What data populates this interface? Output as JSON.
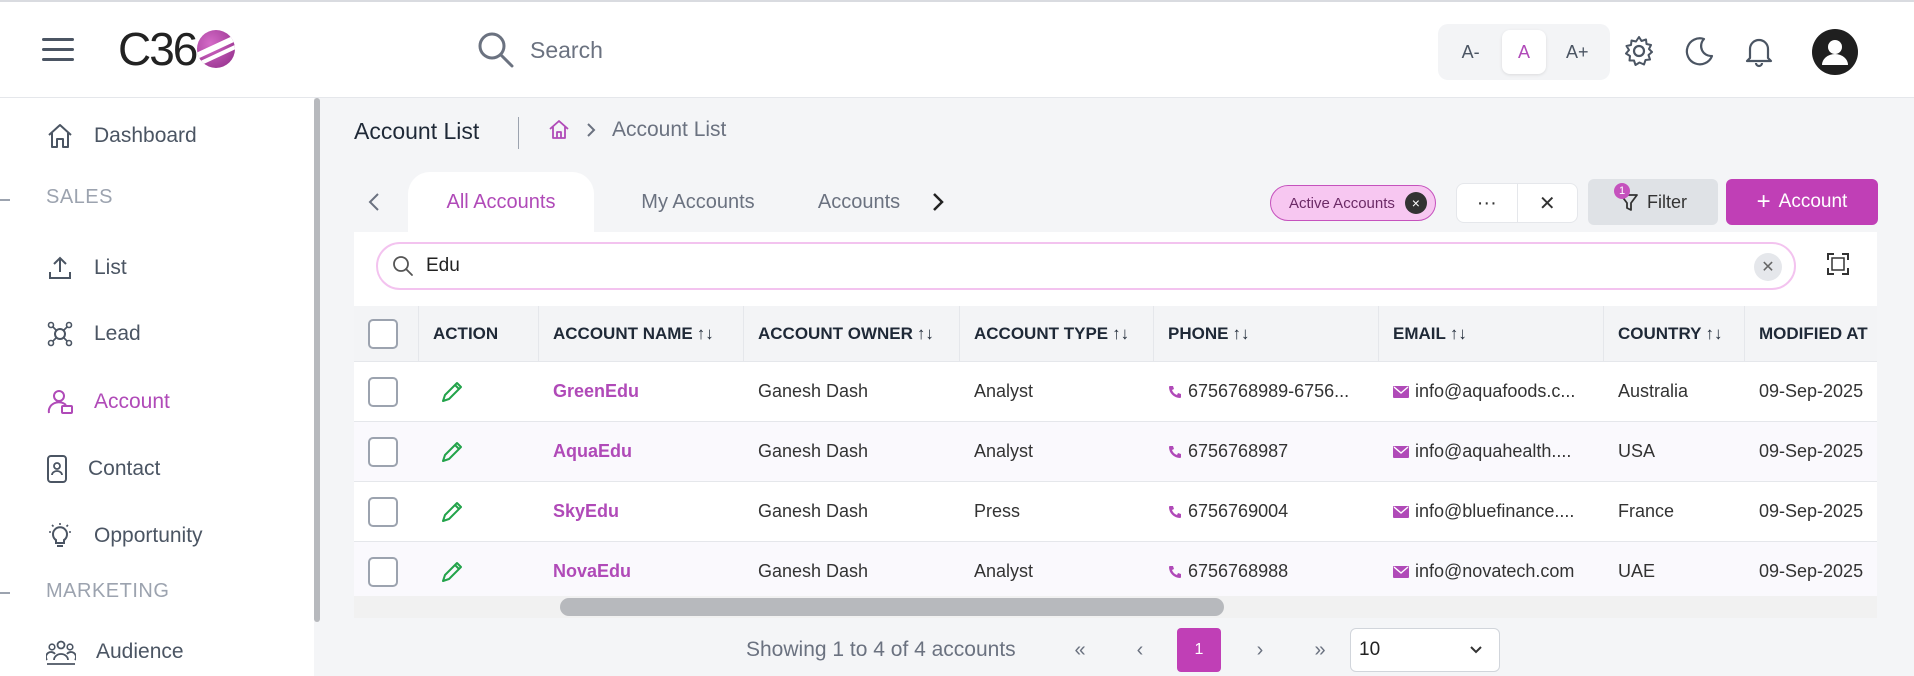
{
  "app": {
    "logo_text": "C36"
  },
  "header": {
    "search_placeholder": "Search",
    "font_small": "A-",
    "font_normal": "A",
    "font_large": "A+"
  },
  "sidebar": {
    "items": [
      {
        "label": "Dashboard",
        "icon": "home-icon"
      },
      {
        "label": "List",
        "icon": "upload-icon"
      },
      {
        "label": "Lead",
        "icon": "lead-icon"
      },
      {
        "label": "Account",
        "icon": "account-icon"
      },
      {
        "label": "Contact",
        "icon": "contact-icon"
      },
      {
        "label": "Opportunity",
        "icon": "lightbulb-icon"
      },
      {
        "label": "Audience",
        "icon": "audience-icon"
      }
    ],
    "sections": {
      "sales": "SALES",
      "marketing": "MARKETING"
    },
    "active_item": "Account"
  },
  "page": {
    "title": "Account List",
    "breadcrumb_current": "Account List"
  },
  "tabs": [
    {
      "label": "All Accounts",
      "active": true
    },
    {
      "label": "My Accounts",
      "active": false
    },
    {
      "label": "Accounts",
      "active": false
    }
  ],
  "toolbar": {
    "chip_label": "Active Accounts",
    "more_label": "···",
    "close_label": "✕",
    "filter_label": "Filter",
    "filter_count": "1",
    "add_label": "Account"
  },
  "table_search": {
    "value": "Edu"
  },
  "table": {
    "columns": [
      "ACTION",
      "ACCOUNT NAME",
      "ACCOUNT OWNER",
      "ACCOUNT TYPE",
      "PHONE",
      "EMAIL",
      "COUNTRY",
      "MODIFIED AT"
    ],
    "rows": [
      {
        "name": "GreenEdu",
        "owner": "Ganesh Dash",
        "type": "Analyst",
        "phone": "6756768989-6756...",
        "email": "info@aquafoods.c...",
        "country": "Australia",
        "modified": "09-Sep-2025"
      },
      {
        "name": "AquaEdu",
        "owner": "Ganesh Dash",
        "type": "Analyst",
        "phone": "6756768987",
        "email": "info@aquahealth....",
        "country": "USA",
        "modified": "09-Sep-2025"
      },
      {
        "name": "SkyEdu",
        "owner": "Ganesh Dash",
        "type": "Press",
        "phone": "6756769004",
        "email": "info@bluefinance....",
        "country": "France",
        "modified": "09-Sep-2025"
      },
      {
        "name": "NovaEdu",
        "owner": "Ganesh Dash",
        "type": "Analyst",
        "phone": "6756768988",
        "email": "info@novatech.com",
        "country": "UAE",
        "modified": "09-Sep-2025"
      }
    ]
  },
  "pagination": {
    "summary": "Showing 1 to 4 of 4 accounts",
    "current_page": "1",
    "page_size": "10"
  },
  "colors": {
    "accent": "#c03fb6",
    "accent_text": "#b04ab8",
    "edit_icon": "#22a34a"
  }
}
